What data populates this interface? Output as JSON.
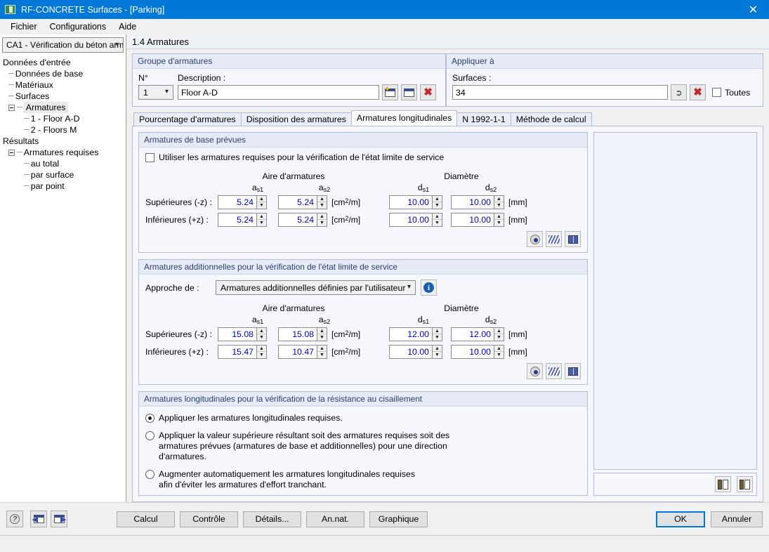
{
  "window": {
    "title": "RF-CONCRETE Surfaces - [Parking]",
    "close_label": "✕"
  },
  "menu": {
    "items": [
      "Fichier",
      "Configurations",
      "Aide"
    ]
  },
  "sidebar": {
    "selector_value": "CA1 - Vérification du béton arm",
    "tree": [
      {
        "label": "Données d'entrée",
        "level": 0,
        "type": "root"
      },
      {
        "label": "Données de base",
        "level": 1,
        "type": "leaf"
      },
      {
        "label": "Matériaux",
        "level": 1,
        "type": "leaf"
      },
      {
        "label": "Surfaces",
        "level": 1,
        "type": "leaf"
      },
      {
        "label": "Armatures",
        "level": 1,
        "type": "branch",
        "selected": true
      },
      {
        "label": "1 - Floor A-D",
        "level": 2,
        "type": "leaf"
      },
      {
        "label": "2 - Floors M",
        "level": 2,
        "type": "leaf"
      },
      {
        "label": "Résultats",
        "level": 0,
        "type": "root"
      },
      {
        "label": "Armatures requises",
        "level": 1,
        "type": "branch"
      },
      {
        "label": "au total",
        "level": 2,
        "type": "leaf"
      },
      {
        "label": "par surface",
        "level": 2,
        "type": "leaf"
      },
      {
        "label": "par point",
        "level": 2,
        "type": "leaf"
      }
    ]
  },
  "page": {
    "header": "1.4 Armatures"
  },
  "reinforcement_group": {
    "title": "Groupe d'armatures",
    "no_label": "N°",
    "no_value": "1",
    "description_label": "Description :",
    "description_value": "Floor A-D",
    "new_icon": "new-window-icon",
    "copy_icon": "copy-window-icon",
    "delete_icon": "delete-red-x-icon"
  },
  "apply_to": {
    "title": "Appliquer à",
    "surfaces_label": "Surfaces :",
    "surfaces_value": "34",
    "pick_icon": "pick-cursor-icon",
    "delete_icon": "delete-red-x-icon",
    "all_checkbox_label": "Toutes",
    "all_checked": false
  },
  "tabs": [
    {
      "label": "Pourcentage d'armatures",
      "active": false
    },
    {
      "label": "Disposition des armatures",
      "active": false
    },
    {
      "label": "Armatures longitudinales",
      "active": true
    },
    {
      "label": "N 1992-1-1",
      "active": false
    },
    {
      "label": "Méthode de calcul",
      "active": false
    }
  ],
  "base_reinforcement": {
    "title": "Armatures de base prévues",
    "checkbox_label": "Utiliser les armatures requises pour la vérification de l'état limite de service",
    "checkbox_checked": false,
    "group_area_header": "Aire d'armatures",
    "group_diameter_header": "Diamètre",
    "col_as1": "a",
    "col_as1_sub": "s1",
    "col_as2": "a",
    "col_as2_sub": "s2",
    "col_ds1": "d",
    "col_ds1_sub": "s1",
    "col_ds2": "d",
    "col_ds2_sub": "s2",
    "unit_area": "[cm²/m]",
    "unit_diameter": "[mm]",
    "rows": [
      {
        "label": "Supérieures (-z) :",
        "as1": "5.24",
        "as2": "5.24",
        "ds1": "10.00",
        "ds2": "10.00"
      },
      {
        "label": "Inférieures (+z) :",
        "as1": "5.24",
        "as2": "5.24",
        "ds1": "10.00",
        "ds2": "10.00"
      }
    ],
    "tools": [
      "eye-icon",
      "rebar-hatch-icon",
      "book-icon"
    ]
  },
  "additional_reinforcement": {
    "title": "Armatures additionnelles pour la vérification de l'état limite de service",
    "approach_label": "Approche de :",
    "approach_value": "Armatures additionnelles définies par l'utilisateur",
    "info_icon": "info-icon",
    "group_area_header": "Aire d'armatures",
    "group_diameter_header": "Diamètre",
    "unit_area": "[cm²/m]",
    "unit_diameter": "[mm]",
    "rows": [
      {
        "label": "Supérieures (-z) :",
        "as1": "15.08",
        "as2": "15.08",
        "ds1": "12.00",
        "ds2": "12.00"
      },
      {
        "label": "Inférieures (+z) :",
        "as1": "15.47",
        "as2": "10.47",
        "ds1": "10.00",
        "ds2": "10.00"
      }
    ],
    "tools": [
      "eye-icon",
      "rebar-hatch-icon",
      "book-icon"
    ]
  },
  "shear_reinforcement": {
    "title": "Armatures longitudinales pour la vérification de la résistance au cisaillement",
    "options": [
      {
        "label": "Appliquer les armatures longitudinales requises.",
        "selected": true
      },
      {
        "label": "Appliquer la valeur supérieure résultant soit des armatures requises soit des armatures prévues (armatures de base et additionnelles) pour une direction d'armatures.",
        "selected": false
      },
      {
        "label": "Augmenter automatiquement les armatures longitudinales requises afin d'éviter les armatures d'effort tranchant.",
        "selected": false
      }
    ]
  },
  "preview": {
    "copy_icon": "copy-to-clipboard-icon",
    "paste_icon": "paste-from-clipboard-icon"
  },
  "bottom": {
    "help_icon": "help-question-icon",
    "prev_icon": "previous-window-icon",
    "next_icon": "next-window-icon",
    "buttons": [
      "Calcul",
      "Contrôle",
      "Détails...",
      "An.nat.",
      "Graphique"
    ],
    "ok_label": "OK",
    "cancel_label": "Annuler"
  },
  "colors": {
    "titlebar": "#0078d7",
    "group_header_text": "#2b4170",
    "value_text": "#0000cd",
    "accent": "#0078d7"
  }
}
